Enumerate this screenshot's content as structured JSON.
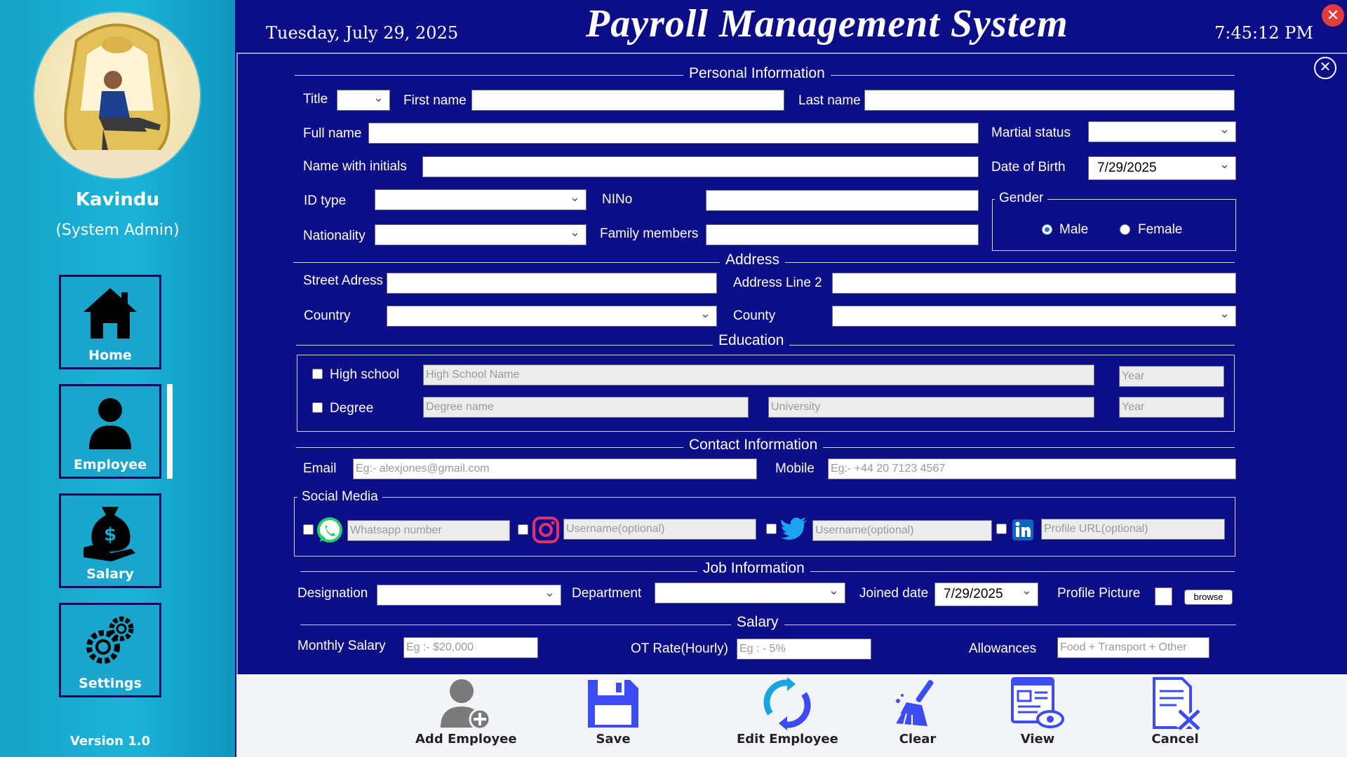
{
  "header": {
    "date": "Tuesday, July 29, 2025",
    "title": "Payroll Management System",
    "time": "7:45:12 PM"
  },
  "sidebar": {
    "user_name": "Kavindu",
    "user_role": "(System Admin)",
    "items": [
      {
        "label": "Home",
        "icon": "home-icon"
      },
      {
        "label": "Employee",
        "icon": "person-icon"
      },
      {
        "label": "Salary",
        "icon": "money-bag-hand-icon"
      },
      {
        "label": "Settings",
        "icon": "gears-icon"
      }
    ],
    "active": "Employee",
    "version": "Version 1.0"
  },
  "personal": {
    "section": "Personal Information",
    "title_label": "Title",
    "first_name_label": "First name",
    "last_name_label": "Last name",
    "full_name_label": "Full name",
    "marital_label": "Martial status",
    "initials_label": "Name with initials",
    "dob_label": "Date of Birth",
    "dob_value": "7/29/2025",
    "id_type_label": "ID type",
    "nino_label": "NINo",
    "gender_label": "Gender",
    "gender_male": "Male",
    "gender_female": "Female",
    "gender_selected": "Male",
    "nationality_label": "Nationality",
    "family_label": "Family members"
  },
  "address": {
    "section": "Address",
    "street_label": "Street Adress",
    "line2_label": "Address Line 2",
    "country_label": "Country",
    "county_label": "County"
  },
  "education": {
    "section": "Education",
    "highschool_label": "High school",
    "highschool_placeholder": "High School Name",
    "year_placeholder": "Year",
    "degree_label": "Degree",
    "degree_placeholder": "Degree name",
    "university_placeholder": "University"
  },
  "contact": {
    "section": "Contact Information",
    "email_label": "Email",
    "email_placeholder": "Eg:- alexjones@gmail.com",
    "mobile_label": "Mobile",
    "mobile_placeholder": "Eg:- +44 20 7123 4567",
    "social_label": "Social Media",
    "whatsapp_placeholder": "Whatsapp number",
    "instagram_placeholder": "Username(optional)",
    "twitter_placeholder": "Username(optional)",
    "linkedin_placeholder": "Profile URL(optional)"
  },
  "job": {
    "section": "Job Information",
    "designation_label": "Designation",
    "department_label": "Department",
    "joined_label": "Joined date",
    "joined_value": "7/29/2025",
    "picture_label": "Profile Picture",
    "browse_label": "browse"
  },
  "salary": {
    "section": "Salary",
    "monthly_label": "Monthly Salary",
    "monthly_placeholder": "Eg :- $20,000",
    "ot_label": "OT Rate(Hourly)",
    "ot_placeholder": "Eg : - 5%",
    "allowances_label": "Allowances",
    "allowances_placeholder": "Food + Transport + Other"
  },
  "toolbar": {
    "add": "Add Employee",
    "save": "Save",
    "edit": "Edit Employee",
    "clear": "Clear",
    "view": "View",
    "cancel": "Cancel"
  },
  "colors": {
    "navy": "#0b0e86",
    "sidebar": "#16a3c6",
    "close_red": "#e23b3b"
  }
}
